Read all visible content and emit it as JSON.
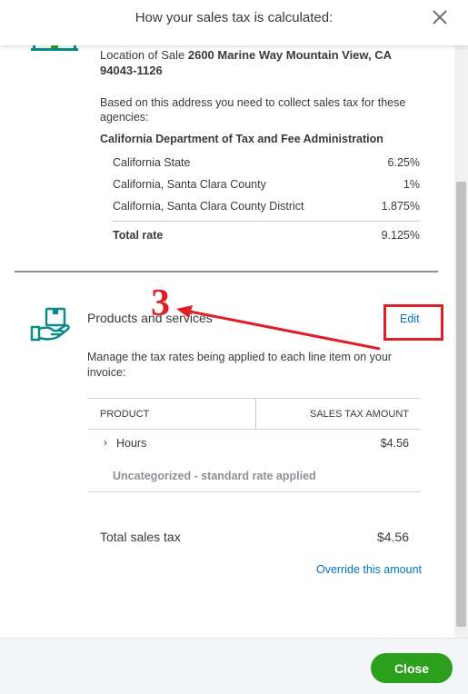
{
  "header": {
    "title": "How your sales tax is calculated:"
  },
  "location": {
    "label": "Location of Sale",
    "address_line1": "2600 Marine Way Mountain View, CA",
    "address_line2": "94043-1126"
  },
  "agencies_note": "Based on this address you need to collect sales tax for these agencies:",
  "agency_name": "California Department of Tax and Fee Administration",
  "rates": [
    {
      "label": "California State",
      "value": "6.25%"
    },
    {
      "label": "California, Santa Clara County",
      "value": "1%"
    },
    {
      "label": "California, Santa Clara County District",
      "value": "1.875%"
    }
  ],
  "total_rate": {
    "label": "Total rate",
    "value": "9.125%"
  },
  "products": {
    "title": "Products and services",
    "edit_label": "Edit",
    "description": "Manage the tax rates being applied to each line item on your invoice:",
    "col_product": "PRODUCT",
    "col_amount": "SALES TAX AMOUNT",
    "row_name": "Hours",
    "row_amount": "$4.56",
    "row_note": "Uncategorized - standard rate applied"
  },
  "total_sales_tax": {
    "label": "Total sales tax",
    "value": "$4.56"
  },
  "override_label": "Override this amount",
  "annotation": {
    "number": "3",
    "color": "#e01e25"
  },
  "footer": {
    "close_label": "Close"
  },
  "colors": {
    "accent_green": "#2ca01c",
    "link_blue": "#0077c5",
    "icon_teal": "#0d8a8a"
  }
}
